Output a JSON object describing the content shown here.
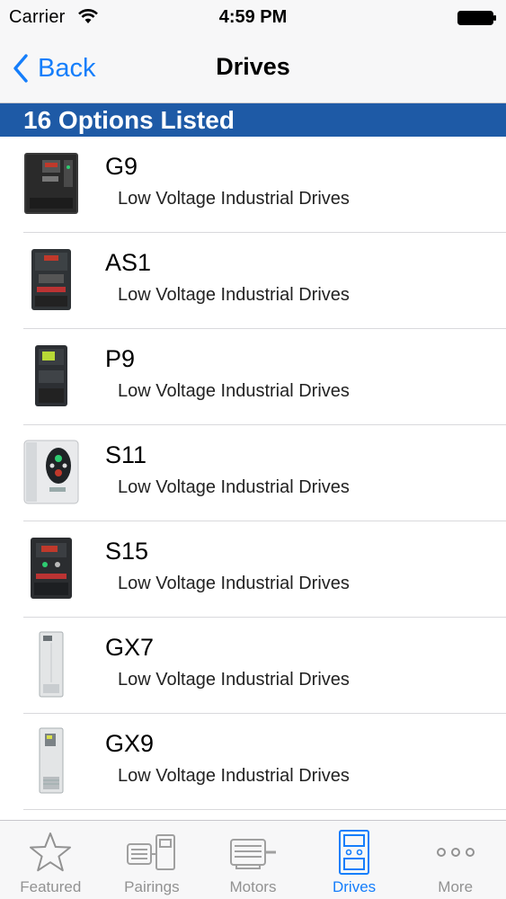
{
  "status_bar": {
    "carrier": "Carrier",
    "time": "4:59 PM"
  },
  "nav": {
    "back_label": "Back",
    "title": "Drives"
  },
  "section_header": "16 Options Listed",
  "items": [
    {
      "title": "G9",
      "subtitle": "Low Voltage Industrial Drives",
      "icon": "drive-g9-icon"
    },
    {
      "title": "AS1",
      "subtitle": "Low Voltage Industrial Drives",
      "icon": "drive-as1-icon"
    },
    {
      "title": "P9",
      "subtitle": "Low Voltage Industrial Drives",
      "icon": "drive-p9-icon"
    },
    {
      "title": "S11",
      "subtitle": "Low Voltage Industrial Drives",
      "icon": "drive-s11-icon"
    },
    {
      "title": "S15",
      "subtitle": "Low Voltage Industrial Drives",
      "icon": "drive-s15-icon"
    },
    {
      "title": "GX7",
      "subtitle": "Low Voltage Industrial Drives",
      "icon": "drive-gx7-icon"
    },
    {
      "title": "GX9",
      "subtitle": "Low Voltage Industrial Drives",
      "icon": "drive-gx9-icon"
    }
  ],
  "tabs": [
    {
      "label": "Featured",
      "icon": "star-icon",
      "active": false
    },
    {
      "label": "Pairings",
      "icon": "pairings-icon",
      "active": false
    },
    {
      "label": "Motors",
      "icon": "motor-icon",
      "active": false
    },
    {
      "label": "Drives",
      "icon": "drive-icon",
      "active": true
    },
    {
      "label": "More",
      "icon": "more-icon",
      "active": false
    }
  ],
  "colors": {
    "accent": "#157efb",
    "section_header_bg": "#1e5aa6",
    "tab_inactive": "#929292"
  }
}
